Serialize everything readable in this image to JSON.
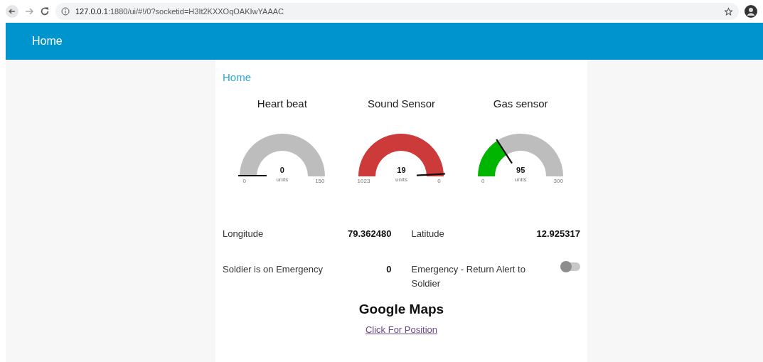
{
  "browser": {
    "url_host": "127.0.0.1",
    "url_rest": ":1880/ui/#!/0?socketid=H3It2KXXOqOAKIwYAAAC"
  },
  "toolbar": {
    "title": "Home"
  },
  "group": {
    "title": "Home"
  },
  "gauges": [
    {
      "title": "Heart beat",
      "value": "0",
      "units": "units",
      "min": "0",
      "max": "150",
      "kind": "partial"
    },
    {
      "title": "Sound Sensor",
      "value": "19",
      "units": "units",
      "min": "1023",
      "max": "0",
      "kind": "full",
      "color": "#cc3a3a"
    },
    {
      "title": "Gas sensor",
      "value": "95",
      "units": "units",
      "min": "0",
      "max": "300",
      "kind": "partial",
      "color": "#00b500"
    }
  ],
  "readings": [
    {
      "kind": "text",
      "label": "Longitude",
      "value": "79.362480"
    },
    {
      "kind": "text",
      "label": "Latitude",
      "value": "12.925317"
    },
    {
      "kind": "text",
      "label": "Soldier is on Emergency",
      "value": "0"
    },
    {
      "kind": "switch",
      "label": "Emergency - Return Alert to Soldier",
      "on": false
    }
  ],
  "maps": {
    "title": "Google Maps",
    "link": "Click For Position"
  }
}
